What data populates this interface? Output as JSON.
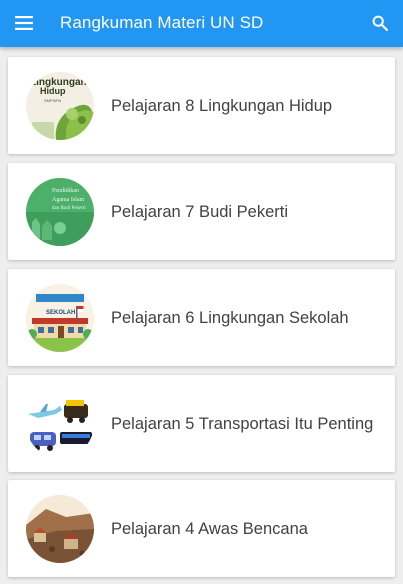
{
  "appbar": {
    "title": "Rangkuman Materi UN SD",
    "color": "#2196f3",
    "menu_icon": "hamburger-menu-icon",
    "search_icon": "search-icon"
  },
  "lessons": [
    {
      "label": "Pelajaran 8 Lingkungan Hidup",
      "thumb_icon": "lingkungan-hidup-book-cover",
      "thumb_text": [
        "Lingkungan",
        "Hidup",
        "SMP/MTs"
      ]
    },
    {
      "label": "Pelajaran 7 Budi Pekerti",
      "thumb_icon": "budi-pekerti-book-cover",
      "thumb_text": [
        "Pendidikan",
        "Agama Islam",
        "dan Budi Pekerti"
      ]
    },
    {
      "label": "Pelajaran 6 Lingkungan Sekolah",
      "thumb_icon": "school-building-illustration",
      "thumb_text": [
        "SEKOLAH"
      ]
    },
    {
      "label": "Pelajaran 5 Transportasi Itu Penting",
      "thumb_icon": "transportation-vehicles-illustration"
    },
    {
      "label": "Pelajaran 4 Awas Bencana",
      "thumb_icon": "disaster-landslide-illustration"
    }
  ]
}
